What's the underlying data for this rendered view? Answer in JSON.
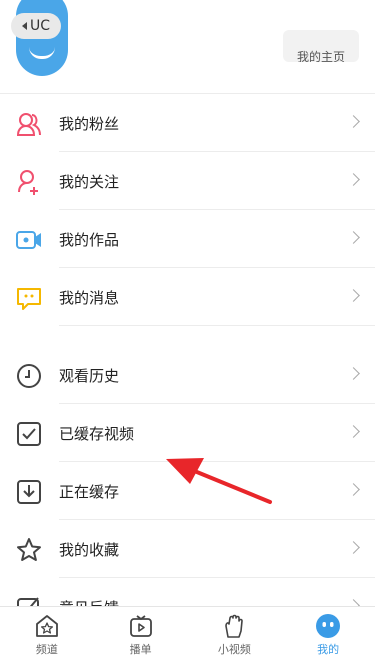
{
  "back": {
    "label": "UC"
  },
  "profile": {
    "button_label": "我的主页"
  },
  "menu_group1": [
    {
      "label": "我的粉丝",
      "icon": "fans-icon"
    },
    {
      "label": "我的关注",
      "icon": "follow-icon"
    },
    {
      "label": "我的作品",
      "icon": "video-camera-icon"
    },
    {
      "label": "我的消息",
      "icon": "message-icon"
    }
  ],
  "menu_group2": [
    {
      "label": "观看历史",
      "icon": "clock-icon"
    },
    {
      "label": "已缓存视频",
      "icon": "checkbox-icon"
    },
    {
      "label": "正在缓存",
      "icon": "download-icon"
    },
    {
      "label": "我的收藏",
      "icon": "star-icon"
    },
    {
      "label": "意见反馈",
      "icon": "edit-icon"
    }
  ],
  "tabbar": [
    {
      "label": "频道",
      "icon": "home-icon",
      "active": false
    },
    {
      "label": "播单",
      "icon": "playlist-icon",
      "active": false
    },
    {
      "label": "小视频",
      "icon": "hand-icon",
      "active": false
    },
    {
      "label": "我的",
      "icon": "profile-face-icon",
      "active": true
    }
  ],
  "colors": {
    "accent": "#3a9be6",
    "pink": "#f0506e",
    "blue": "#4aa6e8",
    "yellow": "#f5b800",
    "arrow": "#e8262a"
  }
}
